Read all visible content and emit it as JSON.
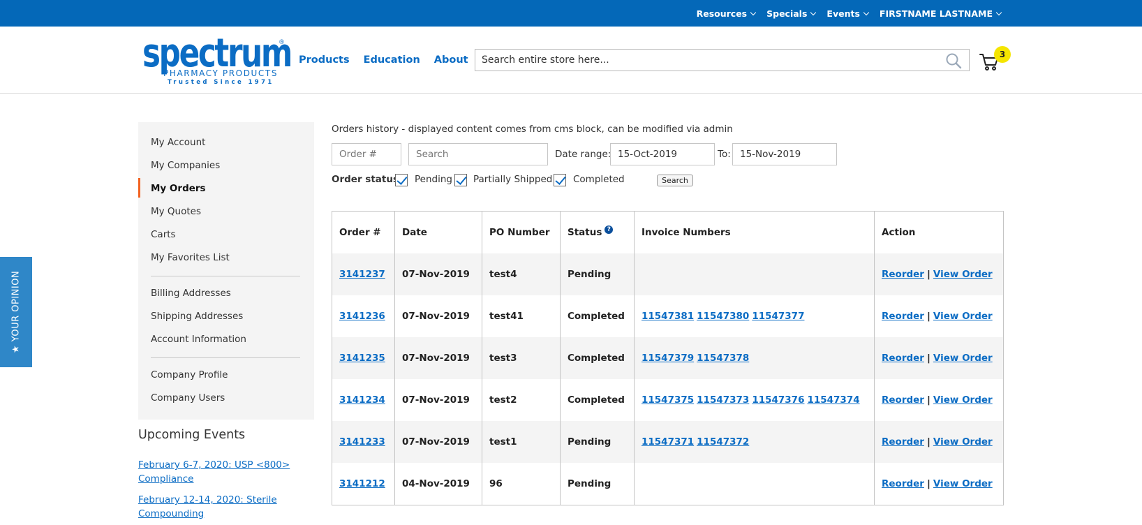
{
  "topbar": {
    "items": [
      "Resources",
      "Specials",
      "Events",
      "FIRSTNAME LASTNAME"
    ]
  },
  "logo": {
    "word": "spectrum",
    "reg": "®",
    "subtitle": "PHARMACY PRODUCTS",
    "tagline": "Trusted Since 1971"
  },
  "nav": [
    "Products",
    "Education",
    "About"
  ],
  "search": {
    "placeholder": "Search entire store here..."
  },
  "cart": {
    "count": "3"
  },
  "sidebar": {
    "items": [
      "My Account",
      "My Companies",
      "My Orders",
      "My Quotes",
      "Carts",
      "My Favorites List",
      "Billing Addresses",
      "Shipping Addresses",
      "Account Information",
      "Company Profile",
      "Company Users"
    ],
    "active": "My Orders"
  },
  "events": {
    "title": "Upcoming Events",
    "links": [
      "February 6-7, 2020: USP <800> Compliance",
      "February 12-14, 2020: Sterile Compounding"
    ]
  },
  "opinion": {
    "label": "★ YOUR OPINION"
  },
  "orders": {
    "intro": "Orders history - displayed content comes from cms block, can be modified via admin",
    "order_placeholder": "Order #",
    "search_placeholder": "Search",
    "date_range_label": "Date range:",
    "date_from": "15-Oct-2019",
    "to_label": "To:",
    "date_to": "15-Nov-2019",
    "status_label": "Order status:",
    "statuses": [
      "Pending",
      "Partially Shipped",
      "Completed"
    ],
    "search_button": "Search",
    "columns": [
      "Order #",
      "Date",
      "PO Number",
      "Status",
      "Invoice Numbers",
      "Action"
    ],
    "status_help": "?",
    "rows": [
      {
        "order": "3141237",
        "date": "07-Nov-2019",
        "po": "test4",
        "status": "Pending",
        "invoices": []
      },
      {
        "order": "3141236",
        "date": "07-Nov-2019",
        "po": "test41",
        "status": "Completed",
        "invoices": [
          "11547381",
          "11547380",
          "11547377"
        ]
      },
      {
        "order": "3141235",
        "date": "07-Nov-2019",
        "po": "test3",
        "status": "Completed",
        "invoices": [
          "11547379",
          "11547378"
        ]
      },
      {
        "order": "3141234",
        "date": "07-Nov-2019",
        "po": "test2",
        "status": "Completed",
        "invoices": [
          "11547375",
          "11547373",
          "11547376",
          "11547374"
        ]
      },
      {
        "order": "3141233",
        "date": "07-Nov-2019",
        "po": "test1",
        "status": "Pending",
        "invoices": [
          "11547371",
          "11547372"
        ]
      },
      {
        "order": "3141212",
        "date": "04-Nov-2019",
        "po": "96",
        "status": "Pending",
        "invoices": []
      }
    ],
    "action_reorder": "Reorder",
    "action_sep": "|",
    "action_view": "View Order"
  }
}
